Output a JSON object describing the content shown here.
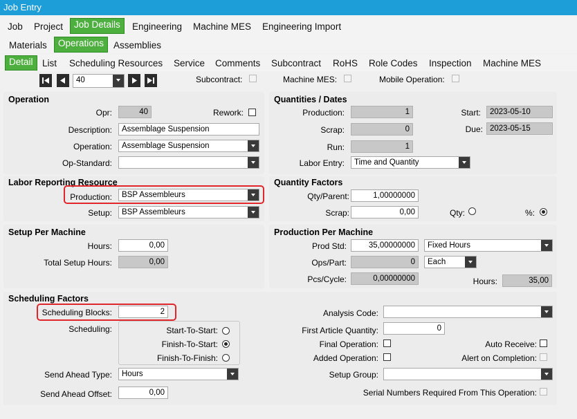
{
  "window": {
    "title": "Job Entry"
  },
  "tabs_level1": [
    "Job",
    "Project",
    "Job Details",
    "Engineering",
    "Machine MES",
    "Engineering Import"
  ],
  "tabs_level2": [
    "Materials",
    "Operations",
    "Assemblies"
  ],
  "tabs_level3": [
    "Detail",
    "List",
    "Scheduling Resources",
    "Service",
    "Comments",
    "Subcontract",
    "RoHS",
    "Role Codes",
    "Inspection",
    "Machine MES"
  ],
  "nav": {
    "current": "40",
    "subcontract_label": "Subcontract:",
    "machine_mes_label": "Machine MES:",
    "mobile_operation_label": "Mobile Operation:"
  },
  "operation": {
    "title": "Operation",
    "opr_label": "Opr:",
    "opr_value": "40",
    "rework_label": "Rework:",
    "description_label": "Description:",
    "description_value": "Assemblage Suspension",
    "operation_label": "Operation:",
    "operation_value": "Assemblage Suspension",
    "opstd_label": "Op-Standard:",
    "opstd_value": ""
  },
  "quantities": {
    "title": "Quantities / Dates",
    "production_label": "Production:",
    "production_value": "1",
    "scrap_label": "Scrap:",
    "scrap_value": "0",
    "run_label": "Run:",
    "run_value": "1",
    "labor_entry_label": "Labor Entry:",
    "labor_entry_value": "Time and Quantity",
    "start_label": "Start:",
    "start_value": "2023-05-10",
    "due_label": "Due:",
    "due_value": "2023-05-15"
  },
  "labor": {
    "title": "Labor Reporting Resource",
    "production_label": "Production:",
    "production_value": "BSP Assembleurs",
    "setup_label": "Setup:",
    "setup_value": "BSP Assembleurs"
  },
  "qty_factors": {
    "title": "Quantity Factors",
    "qty_parent_label": "Qty/Parent:",
    "qty_parent_value": "1,00000000",
    "scrap_label": "Scrap:",
    "scrap_value": "0,00",
    "qty_label": "Qty:",
    "pct_label": "%:"
  },
  "setup_machine": {
    "title": "Setup Per Machine",
    "hours_label": "Hours:",
    "hours_value": "0,00",
    "total_label": "Total Setup Hours:",
    "total_value": "0,00"
  },
  "prod_machine": {
    "title": "Production Per Machine",
    "prod_std_label": "Prod Std:",
    "prod_std_value": "35,00000000",
    "prod_std_unit": "Fixed Hours",
    "ops_part_label": "Ops/Part:",
    "ops_part_value": "0",
    "ops_part_unit": "Each",
    "pcs_cycle_label": "Pcs/Cycle:",
    "pcs_cycle_value": "0,00000000",
    "hours_label": "Hours:",
    "hours_value": "35,00"
  },
  "scheduling": {
    "title": "Scheduling Factors",
    "blocks_label": "Scheduling Blocks:",
    "blocks_value": "2",
    "scheduling_label": "Scheduling:",
    "options": [
      "Start-To-Start:",
      "Finish-To-Start:",
      "Finish-To-Finish:"
    ],
    "send_ahead_type_label": "Send Ahead Type:",
    "send_ahead_type_value": "Hours",
    "send_ahead_offset_label": "Send Ahead Offset:",
    "send_ahead_offset_value": "0,00",
    "analysis_code_label": "Analysis Code:",
    "analysis_code_value": "",
    "first_article_label": "First Article Quantity:",
    "first_article_value": "0",
    "final_operation_label": "Final Operation:",
    "added_operation_label": "Added Operation:",
    "auto_receive_label": "Auto Receive:",
    "alert_label": "Alert on Completion:",
    "setup_group_label": "Setup Group:",
    "setup_group_value": "",
    "serial_label": "Serial Numbers Required From This Operation:"
  },
  "colors": {
    "title_bar": "#1e9ed9",
    "active_tab": "#4daf3e",
    "highlight": "#e0262b"
  }
}
